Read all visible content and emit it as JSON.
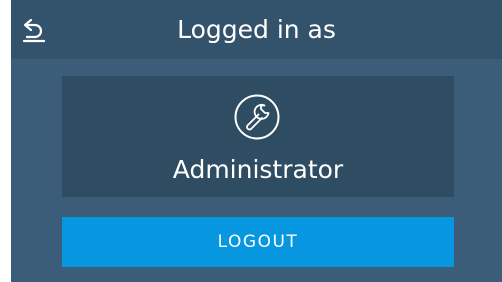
{
  "header": {
    "title": "Logged in as",
    "back_icon": "back-arrow-icon"
  },
  "user": {
    "role": "Administrator",
    "icon": "wrench-icon"
  },
  "actions": {
    "logout_label": "LOGOUT"
  },
  "colors": {
    "background": "#3b5d79",
    "header": "#33526c",
    "card": "#2e4c62",
    "accent": "#0796e0",
    "text": "#ffffff"
  }
}
